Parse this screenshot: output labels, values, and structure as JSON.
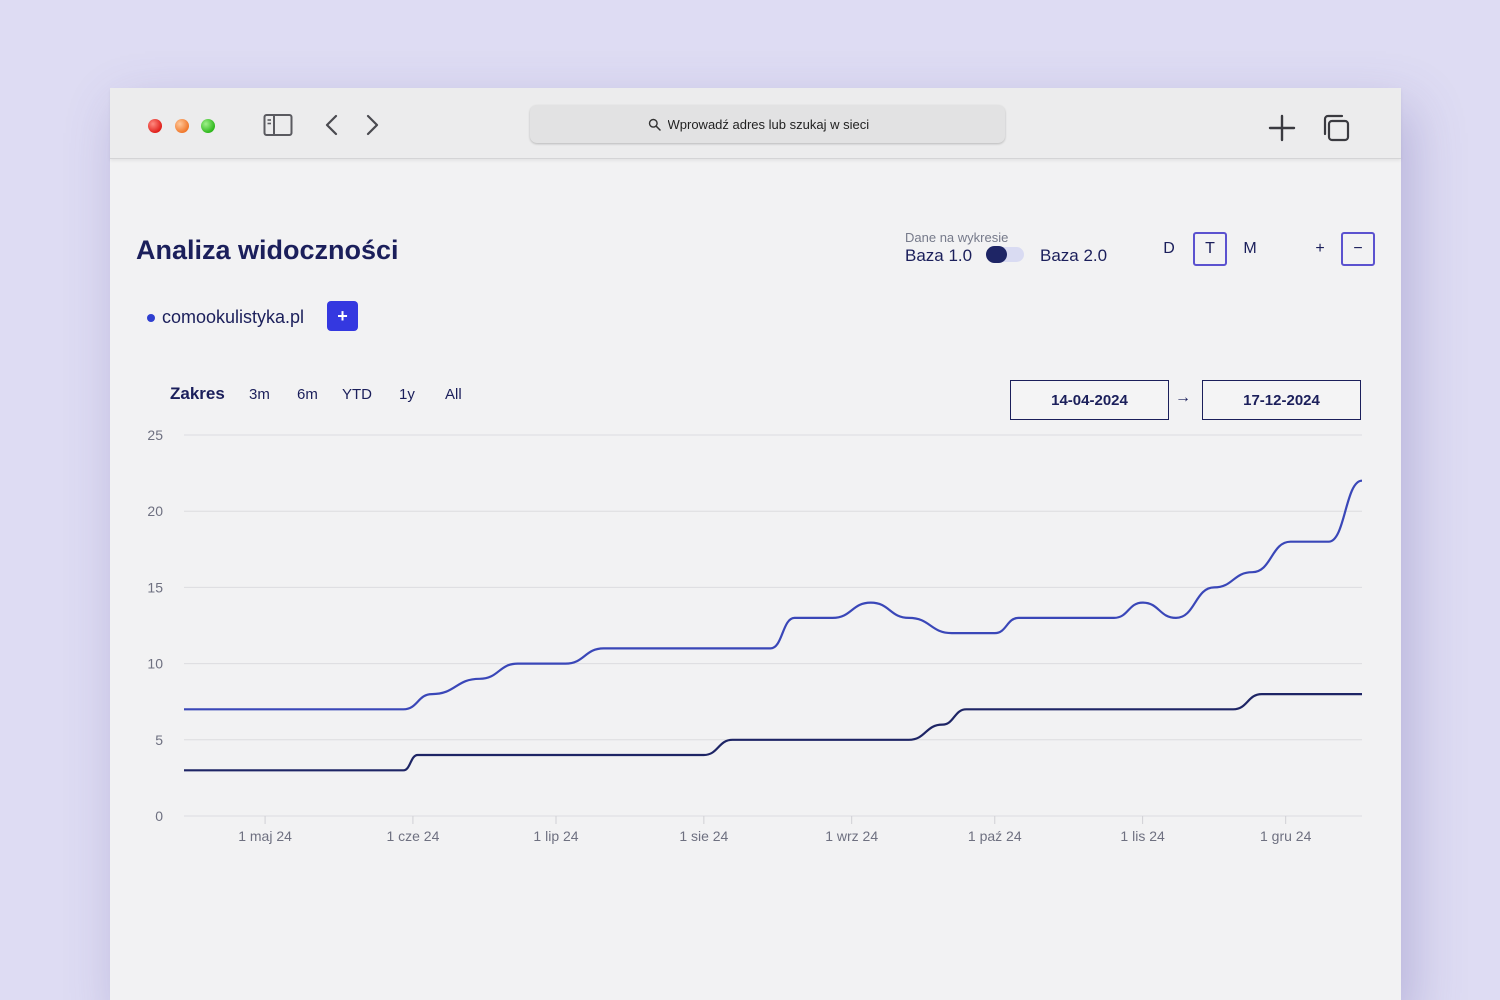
{
  "browser": {
    "address_placeholder": "Wprowadź adres lub szukaj w sieci"
  },
  "page": {
    "title": "Analiza widoczności",
    "data_source": {
      "label": "Dane na wykresie",
      "option_left": "Baza 1.0",
      "option_right": "Baza 2.0",
      "selected": "Baza 1.0"
    },
    "periods": [
      {
        "label": "D",
        "active": false
      },
      {
        "label": "T",
        "active": true
      },
      {
        "label": "M",
        "active": false
      }
    ],
    "zoom": {
      "in_label": "+",
      "out_label": "−"
    },
    "domain": {
      "name": "comookulistyka.pl",
      "add_label": "+",
      "color": "#2f3fd0"
    },
    "range": {
      "label": "Zakres",
      "options": [
        "3m",
        "6m",
        "YTD",
        "1y",
        "All"
      ],
      "date_from": "14-04-2024",
      "arrow": "→",
      "date_to": "17-12-2024"
    }
  },
  "chart_data": {
    "type": "line",
    "x_range": [
      "2024-04-14",
      "2024-12-17"
    ],
    "x_ticks": [
      {
        "date": "2024-05-01",
        "label": "1 maj 24"
      },
      {
        "date": "2024-06-01",
        "label": "1 cze 24"
      },
      {
        "date": "2024-07-01",
        "label": "1 lip 24"
      },
      {
        "date": "2024-08-01",
        "label": "1 sie 24"
      },
      {
        "date": "2024-09-01",
        "label": "1 wrz 24"
      },
      {
        "date": "2024-10-01",
        "label": "1 paź 24"
      },
      {
        "date": "2024-11-01",
        "label": "1 lis 24"
      },
      {
        "date": "2024-12-01",
        "label": "1 gru 24"
      }
    ],
    "y_ticks": [
      0,
      5,
      10,
      15,
      20,
      25
    ],
    "ylim": [
      0,
      25
    ],
    "grid": true,
    "series": [
      {
        "color": "#3a47b8",
        "points": [
          [
            "2024-04-14",
            7
          ],
          [
            "2024-05-30",
            7
          ],
          [
            "2024-06-05",
            8
          ],
          [
            "2024-06-15",
            9
          ],
          [
            "2024-06-23",
            10
          ],
          [
            "2024-07-03",
            10
          ],
          [
            "2024-07-11",
            11
          ],
          [
            "2024-08-01",
            11
          ],
          [
            "2024-08-15",
            11
          ],
          [
            "2024-08-20",
            13
          ],
          [
            "2024-08-28",
            13
          ],
          [
            "2024-09-05",
            14
          ],
          [
            "2024-09-13",
            13
          ],
          [
            "2024-09-22",
            12
          ],
          [
            "2024-10-01",
            12
          ],
          [
            "2024-10-06",
            13
          ],
          [
            "2024-10-26",
            13
          ],
          [
            "2024-11-01",
            14
          ],
          [
            "2024-11-08",
            13
          ],
          [
            "2024-11-16",
            15
          ],
          [
            "2024-11-24",
            16
          ],
          [
            "2024-12-02",
            18
          ],
          [
            "2024-12-10",
            18
          ],
          [
            "2024-12-17",
            22
          ]
        ]
      },
      {
        "color": "#1e2565",
        "points": [
          [
            "2024-04-14",
            3
          ],
          [
            "2024-05-30",
            3
          ],
          [
            "2024-06-02",
            4
          ],
          [
            "2024-08-01",
            4
          ],
          [
            "2024-08-07",
            5
          ],
          [
            "2024-09-13",
            5
          ],
          [
            "2024-09-20",
            6
          ],
          [
            "2024-09-25",
            7
          ],
          [
            "2024-11-01",
            7
          ],
          [
            "2024-11-20",
            7
          ],
          [
            "2024-11-26",
            8
          ],
          [
            "2024-12-17",
            8
          ]
        ]
      }
    ]
  }
}
